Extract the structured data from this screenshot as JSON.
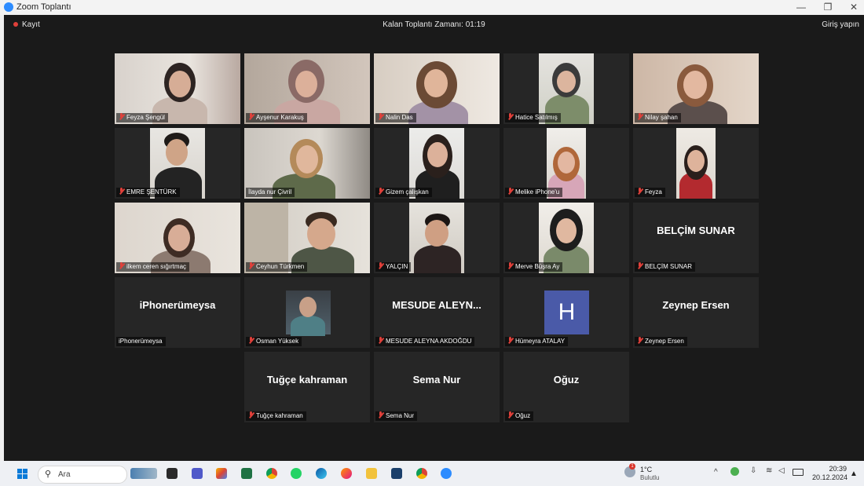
{
  "window": {
    "title": "Zoom Toplantı",
    "minimize": "—",
    "restore": "❐",
    "close": "✕"
  },
  "meeting": {
    "recording_label": "Kayıt",
    "time_left": "Kalan Toplantı Zamanı: 01:19",
    "sign_in": "Giriş yapın"
  },
  "tiles": [
    {
      "name": "Feyza Şengül",
      "muted": true
    },
    {
      "name": "Ayşenur Karakuş",
      "muted": true
    },
    {
      "name": "Nalin Das",
      "muted": true
    },
    {
      "name": "Hatice Satılmış",
      "muted": true
    },
    {
      "name": "Nilay şahan",
      "muted": true
    },
    {
      "name": "EMRE ŞENTÜRK",
      "muted": true
    },
    {
      "name": "İlayda nur Çivril",
      "muted": false,
      "active": true
    },
    {
      "name": "Gizem çalışkan",
      "muted": true
    },
    {
      "name": "Melike iPhone'u",
      "muted": true
    },
    {
      "name": "Feyza",
      "muted": true
    },
    {
      "name": "ilkem ceren sığırtmaç",
      "muted": true
    },
    {
      "name": "Ceyhun Türkmen",
      "muted": true
    },
    {
      "name": "YALÇIN",
      "muted": true
    },
    {
      "name": "Merve Büşra Ay",
      "muted": true
    },
    {
      "name": "BELÇİM SUNAR",
      "muted": true,
      "big": "BELÇİM SUNAR"
    },
    {
      "name": "iPhonerümeysa",
      "muted": false,
      "big": "iPhonerümeysa"
    },
    {
      "name": "Osman Yüksek",
      "muted": true
    },
    {
      "name": "MESUDE ALEYNA AKDOĞDU",
      "muted": true,
      "big": "MESUDE ALEYN..."
    },
    {
      "name": "Hümeyra ATALAY",
      "muted": true,
      "avatar": "H"
    },
    {
      "name": "Zeynep Ersen",
      "muted": true,
      "big": "Zeynep Ersen"
    },
    {
      "name": "Tuğçe kahraman",
      "muted": true,
      "big": "Tuğçe kahraman"
    },
    {
      "name": "Sema Nur",
      "muted": true,
      "big": "Sema Nur"
    },
    {
      "name": "Oğuz",
      "muted": true,
      "big": "Oğuz"
    }
  ],
  "taskbar": {
    "search_placeholder": "Ara",
    "weather_temp": "1°C",
    "weather_cond": "Bulutlu",
    "weather_badge": "1",
    "clock_time": "20:39",
    "clock_date": "20.12.2024",
    "colors": {
      "accent": "#2d8cff",
      "active_speaker": "#9bd12a",
      "muted": "#e0403a"
    }
  }
}
